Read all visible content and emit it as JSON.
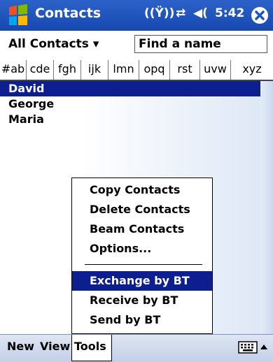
{
  "titlebar": {
    "title": "Contacts",
    "time": "5:42"
  },
  "toolbar": {
    "category": "All Contacts ▾",
    "find_placeholder": "Find a name"
  },
  "alpha_tabs": [
    "#ab",
    "cde",
    "fgh",
    "ijk",
    "lmn",
    "opq",
    "rst",
    "uvw",
    "xyz"
  ],
  "contacts": [
    {
      "name": "David",
      "selected": true
    },
    {
      "name": "George",
      "selected": false
    },
    {
      "name": "Maria",
      "selected": false
    }
  ],
  "tools_menu": {
    "items": [
      {
        "label": "Copy Contacts",
        "selected": false
      },
      {
        "label": "Delete Contacts",
        "selected": false
      },
      {
        "label": "Beam Contacts",
        "selected": false
      },
      {
        "label": "Options...",
        "selected": false
      }
    ],
    "items2": [
      {
        "label": "Exchange by BT",
        "selected": true
      },
      {
        "label": "Receive by BT",
        "selected": false
      },
      {
        "label": "Send by BT",
        "selected": false
      }
    ]
  },
  "bottombar": {
    "new": "New",
    "view": "View",
    "tools": "Tools"
  },
  "colors": {
    "titlebar": "#1d54bd",
    "selection": "#0d1e8f"
  },
  "icons": [
    "windows-start-icon",
    "antenna-icon",
    "connectivity-icon",
    "speaker-icon",
    "close-icon",
    "keyboard-icon",
    "input-arrow-icon"
  ]
}
